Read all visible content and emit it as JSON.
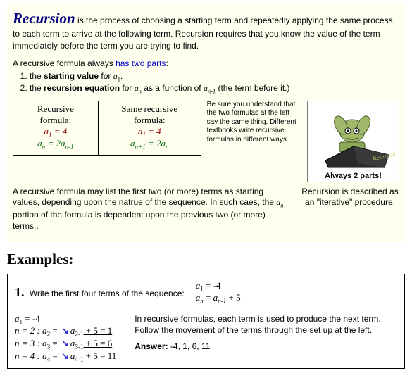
{
  "intro": {
    "head": "Recursion",
    "body1": " is the process of choosing a starting term and repeatedly applying the same process to each term to arrive at the following term.  Recursion requires that you know the value of the term immediately before the term you are trying to find.",
    "partsLead": "A recursive formula always ",
    "partsLink": "has two parts",
    "partsColon": ":",
    "li1_a": "the ",
    "li1_b": "starting value",
    "li1_c": " for ",
    "li1_d": "a",
    "li1_e": "1",
    "li1_f": ".",
    "li2_a": "the ",
    "li2_b": "recursion equation",
    "li2_c": " for ",
    "li2_d": "a",
    "li2_e": "n",
    "li2_f": " as a function of ",
    "li2_g": "a",
    "li2_h": "n-1",
    "li2_i": " (the term before it.)"
  },
  "table": {
    "h1": "Recursive formula:",
    "h2": "Same recursive formula:",
    "r1a": "a",
    "r1b": "1",
    "r1c": " = 4",
    "r2a": "a",
    "r2b": "n",
    "r2c": " = 2",
    "r2d": "a",
    "r2e": "n-1",
    "r3a": "a",
    "r3b": "1",
    "r3c": " = 4",
    "r4a": "a",
    "r4b": "n+1",
    "r4c": " = 2",
    "r4d": "a",
    "r4e": "n"
  },
  "note": "Be sure you understand that the two formulas at the left say the same thing.  Different textbooks write recursive formulas in different ways.",
  "imgcap": "Always 2 parts!",
  "imglabel": "Recursion",
  "dep": {
    "left1": "A recursive formula may list the first two (or more) terms as starting values, depending upon the natrue of the sequence. In such caes, the ",
    "left2": "a",
    "left3": "n",
    "left4": " portion of the formula is dependent upon the previous two (or more) terms..",
    "right": "Recursion is described as an \"iterative\" procedure."
  },
  "examplesHdr": "Examples:",
  "ex1": {
    "num": "1.",
    "prompt": "Write the first four terms of the sequence:",
    "g1a": "a",
    "g1b": "1",
    "g1c": " = -4",
    "g2a": "a",
    "g2b": "n",
    "g2c": " = ",
    "g2d": "a",
    "g2e": "n-1",
    "g2f": " + 5",
    "w0a": "a",
    "w0b": "1",
    "w0c": " = -4",
    "wA": "n = 2 :  ",
    "wAa": "a",
    "wAb": "2",
    "wAc": " = ",
    "wAd": "a",
    "wAe": "2-1",
    "wAf": " + 5 = 1",
    "wB": "n = 3 :  ",
    "wBa": "a",
    "wBb": "3",
    "wBc": " = ",
    "wBd": "a",
    "wBe": "3-1",
    "wBf": " + 5 = 6",
    "wC": "n = 4 :  ",
    "wCa": "a",
    "wCb": "4",
    "wCc": " = ",
    "wCd": "a",
    "wCe": "4-1",
    "wCf": " + 5 = 11",
    "explain": "In recursive formulas, each term is used to produce the next term.  Follow the movement of the terms through the set up at the left.",
    "ansLabel": "Answer:",
    "ansVal": "  -4, 1, 6, 11"
  }
}
